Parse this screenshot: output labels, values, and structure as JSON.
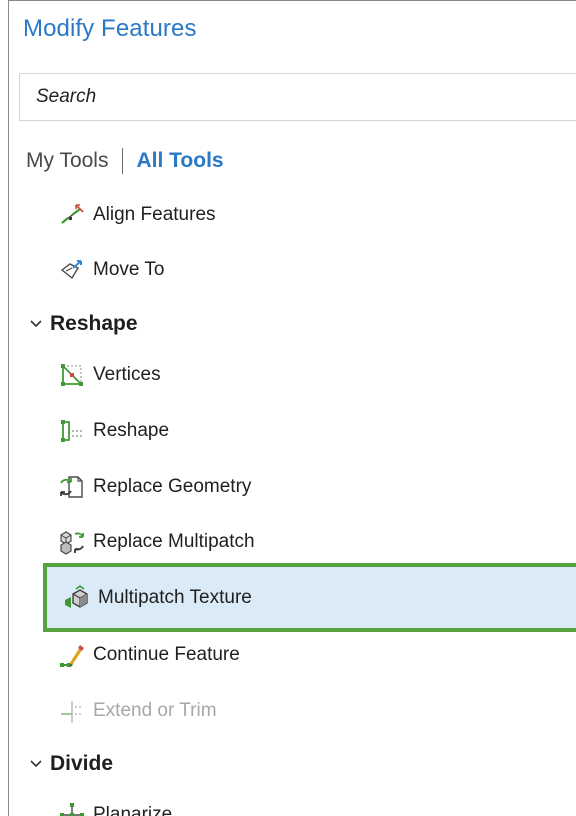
{
  "panel": {
    "title": "Modify Features"
  },
  "search": {
    "placeholder": "Search"
  },
  "mode": {
    "my_tools": "My Tools",
    "all_tools": "All Tools"
  },
  "tools": [
    {
      "label": "Align Features",
      "icon": "align-features-icon"
    },
    {
      "label": "Move To",
      "icon": "move-to-icon"
    }
  ],
  "groups": {
    "reshape": {
      "label": "Reshape",
      "expanded": true,
      "items": [
        {
          "label": "Vertices",
          "icon": "vertices-icon"
        },
        {
          "label": "Reshape",
          "icon": "reshape-icon"
        },
        {
          "label": "Replace Geometry",
          "icon": "replace-geometry-icon"
        },
        {
          "label": "Replace Multipatch",
          "icon": "replace-multipatch-icon"
        },
        {
          "label": "Multipatch Texture",
          "icon": "multipatch-texture-icon",
          "selected": true
        },
        {
          "label": "Continue Feature",
          "icon": "continue-feature-icon"
        },
        {
          "label": "Extend or Trim",
          "icon": "extend-or-trim-icon",
          "disabled": true
        }
      ]
    },
    "divide": {
      "label": "Divide",
      "expanded": true,
      "items": [
        {
          "label": "Planarize",
          "icon": "planarize-icon"
        }
      ]
    }
  },
  "colors": {
    "title": "#2a79c7",
    "accent": "#2a79c7",
    "selected_bg": "#daeaf7",
    "selected_border": "#55a33f",
    "disabled_text": "#a7a7a7"
  }
}
